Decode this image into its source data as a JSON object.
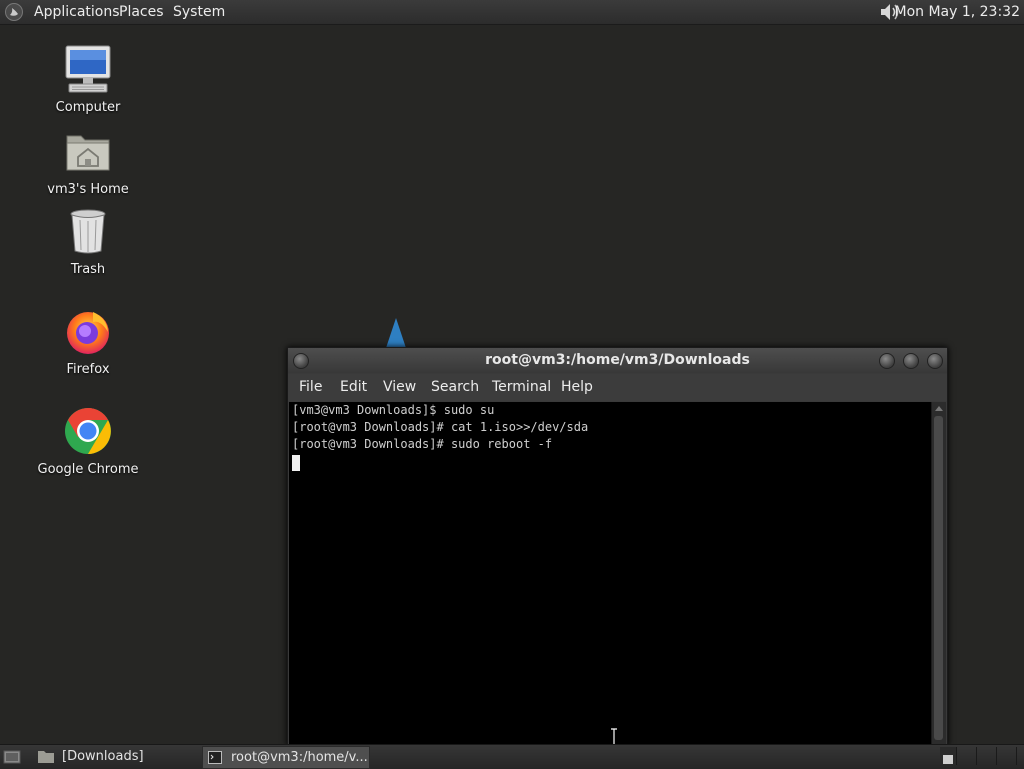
{
  "top_panel": {
    "menus": [
      "Applications",
      "Places",
      "System"
    ],
    "clock": "Mon May  1, 23:32",
    "icons": {
      "foot": "gnome-foot-icon",
      "volume": "volume-icon"
    }
  },
  "desktop": {
    "icons": [
      {
        "label": "Computer",
        "icon": "computer-icon"
      },
      {
        "label": "vm3's Home",
        "icon": "home-folder-icon"
      },
      {
        "label": "Trash",
        "icon": "trash-icon"
      },
      {
        "label": "Firefox",
        "icon": "firefox-icon"
      },
      {
        "label": "Google Chrome",
        "icon": "chrome-icon"
      }
    ]
  },
  "terminal": {
    "title": "root@vm3:/home/vm3/Downloads",
    "menu": [
      "File",
      "Edit",
      "View",
      "Search",
      "Terminal",
      "Help"
    ],
    "lines": [
      "[vm3@vm3 Downloads]$ sudo su",
      "[root@vm3 Downloads]# cat 1.iso>>/dev/sda",
      "[root@vm3 Downloads]# sudo reboot -f"
    ]
  },
  "taskbar": {
    "items": [
      {
        "label": "[Downloads]",
        "icon": "folder-icon",
        "active": false
      },
      {
        "label": "root@vm3:/home/v...",
        "icon": "terminal-icon",
        "active": true
      }
    ]
  },
  "colors": {
    "desktop_bg": "#262624",
    "terminal_bg": "#000000",
    "panel_bg": "#2f2f2f"
  }
}
